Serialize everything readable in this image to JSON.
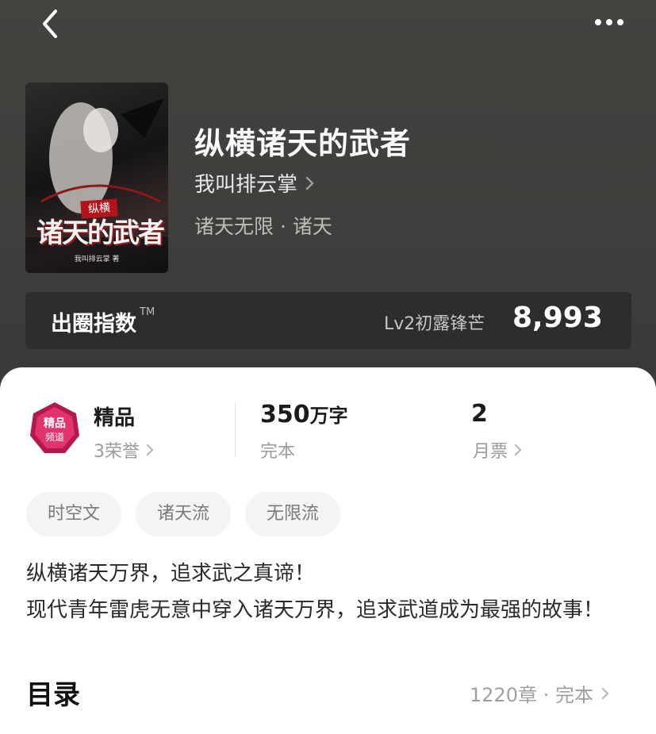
{
  "nav": {
    "back_icon": "chevron-left-icon",
    "more_icon": "more-dots-icon"
  },
  "book": {
    "title": "纵横诸天的武者",
    "author": "我叫排云掌",
    "genre": "诸天无限 · 诸天",
    "cover": {
      "stamp": "纵横",
      "title_art": "诸天的武者",
      "author_line": "我叫排云掌 著"
    }
  },
  "index": {
    "label": "出圈指数",
    "tm": "TM",
    "level": "Lv2初露锋芒",
    "score": "8,993"
  },
  "stats": {
    "badge_title": "精品",
    "honors": "3荣誉",
    "words_num": "350",
    "words_unit": "万字",
    "status": "完本",
    "tickets": "2",
    "tickets_label": "月票"
  },
  "tags": [
    "时空文",
    "诸天流",
    "无限流"
  ],
  "intro": {
    "line1": "纵横诸天万界，追求武之真谛！",
    "line2": "现代青年雷虎无意中穿入诸天万界，追求武道成为最强的故事！"
  },
  "toc": {
    "title": "目录",
    "info": "1220章 · 完本"
  },
  "colors": {
    "header_bg": "#403f3d",
    "panel_bg": "#ffffff",
    "badge": "#b3184f"
  }
}
